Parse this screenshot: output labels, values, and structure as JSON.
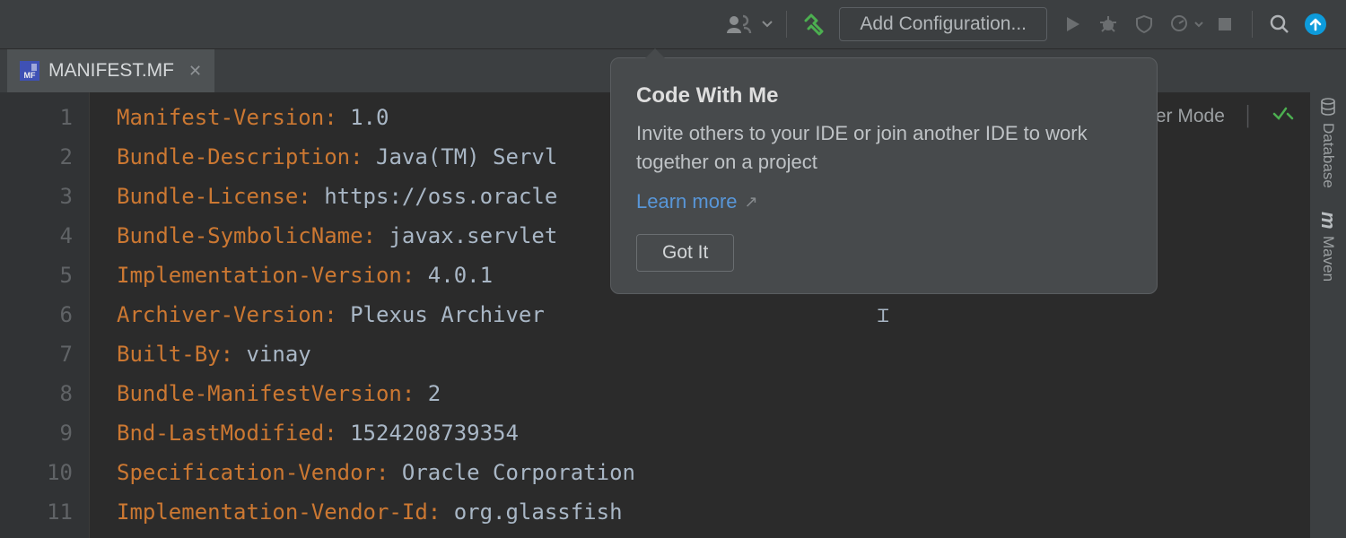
{
  "toolbar": {
    "add_config_label": "Add Configuration..."
  },
  "tab": {
    "filename": "MANIFEST.MF",
    "badge": "MF"
  },
  "editor": {
    "lines": [
      {
        "n": "1",
        "key": "Manifest-Version",
        "val": "1.0"
      },
      {
        "n": "2",
        "key": "Bundle-Description",
        "val": "Java(TM) Servl"
      },
      {
        "n": "3",
        "key": "Bundle-License",
        "val": "https://oss.oracle"
      },
      {
        "n": "4",
        "key": "Bundle-SymbolicName",
        "val": "javax.servlet"
      },
      {
        "n": "5",
        "key": "Implementation-Version",
        "val": "4.0.1"
      },
      {
        "n": "6",
        "key": "Archiver-Version",
        "val": "Plexus Archiver"
      },
      {
        "n": "7",
        "key": "Built-By",
        "val": "vinay"
      },
      {
        "n": "8",
        "key": "Bundle-ManifestVersion",
        "val": "2"
      },
      {
        "n": "9",
        "key": "Bnd-LastModified",
        "val": "1524208739354"
      },
      {
        "n": "10",
        "key": "Specification-Vendor",
        "val": "Oracle Corporation"
      },
      {
        "n": "11",
        "key": "Implementation-Vendor-Id",
        "val": "org.glassfish"
      }
    ]
  },
  "popover": {
    "title": "Code With Me",
    "body": "Invite others to your IDE or join another IDE to work together on a project",
    "learn_more": "Learn more",
    "got_it": "Got It"
  },
  "inspections": {
    "reader_mode": "der Mode"
  },
  "rightstrip": {
    "database": "Database",
    "maven": "Maven"
  }
}
